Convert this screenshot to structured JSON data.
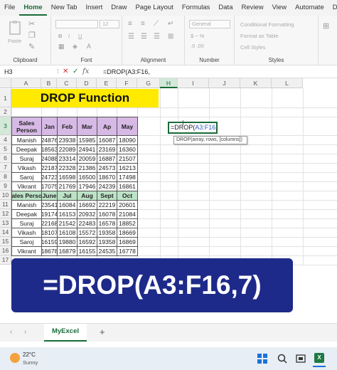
{
  "menu": [
    "File",
    "Home",
    "New Tab",
    "Insert",
    "Draw",
    "Page Layout",
    "Formulas",
    "Data",
    "Review",
    "View",
    "Automate",
    "Develo"
  ],
  "ribbon": {
    "clipboard_label": "Clipboard",
    "paste_label": "Paste",
    "font_label": "Font",
    "font_size": "12",
    "alignment_label": "Alignment",
    "number_label": "Number",
    "number_format": "General",
    "styles_label": "Styles",
    "conditional_formatting": "Conditional Formatting",
    "format_as_table": "Format as Table",
    "cell_styles": "Cell Styles",
    "bold": "B",
    "italic": "I",
    "underline": "U"
  },
  "formula_bar": {
    "name_box": "H3",
    "formula": "=DROP(A3:F16,",
    "fx": "fx"
  },
  "columns": [
    "A",
    "B",
    "C",
    "D",
    "E",
    "F",
    "G",
    "H",
    "I",
    "J",
    "K",
    "L"
  ],
  "selected_column": "H",
  "rows": [
    "1",
    "2",
    "3",
    "4",
    "5",
    "6",
    "7",
    "8",
    "9",
    "10",
    "11",
    "12",
    "13",
    "14",
    "15",
    "16",
    "17"
  ],
  "selected_row": "3",
  "title": "DROP Function",
  "table1": {
    "headers": [
      "Sales Person",
      "Jan",
      "Feb",
      "Mar",
      "Ap",
      "May"
    ],
    "rows": [
      [
        "Manish",
        "24876",
        "23938",
        "15985",
        "16087",
        "18090"
      ],
      [
        "Deepak",
        "18563",
        "22089",
        "24941",
        "23169",
        "16360"
      ],
      [
        "Suraj",
        "24088",
        "23314",
        "20059",
        "16887",
        "21507"
      ],
      [
        "Vikash",
        "22187",
        "22328",
        "21386",
        "24573",
        "16213"
      ],
      [
        "Saroj",
        "24723",
        "16598",
        "16500",
        "18670",
        "17498"
      ],
      [
        "Vikrant",
        "17075",
        "21769",
        "17946",
        "24239",
        "16861"
      ]
    ]
  },
  "table2": {
    "headers": [
      "Sales Person",
      "June",
      "Jul",
      "Aug",
      "Sept",
      "Oct"
    ],
    "rows": [
      [
        "Manish",
        "23541",
        "16084",
        "16692",
        "22219",
        "20601"
      ],
      [
        "Deepak",
        "19174",
        "16153",
        "20932",
        "16078",
        "21084"
      ],
      [
        "Suraj",
        "22168",
        "21542",
        "22483",
        "16578",
        "18852"
      ],
      [
        "Vikash",
        "18107",
        "16108",
        "15572",
        "19358",
        "18669"
      ],
      [
        "Saroj",
        "16159",
        "19880",
        "16592",
        "19358",
        "16869"
      ],
      [
        "Vikrant",
        "18678",
        "16879",
        "16155",
        "24535",
        "16778"
      ]
    ]
  },
  "active_cell": {
    "prefix": "=DROP(",
    "ref": "A3:F16",
    "suffix": ","
  },
  "tooltip": "DROP(array, rows, [columns])",
  "banner": "=DROP(A3:F16,7)",
  "sheet_tab": "MyExcel",
  "weather": {
    "temp": "22°C",
    "desc": "Sunny"
  },
  "colors": {
    "accent": "#1a6b38",
    "banner": "#1e2a8a",
    "title_bg": "#ffea00",
    "header1": "#d7b9e6",
    "header2": "#bde3c7"
  }
}
